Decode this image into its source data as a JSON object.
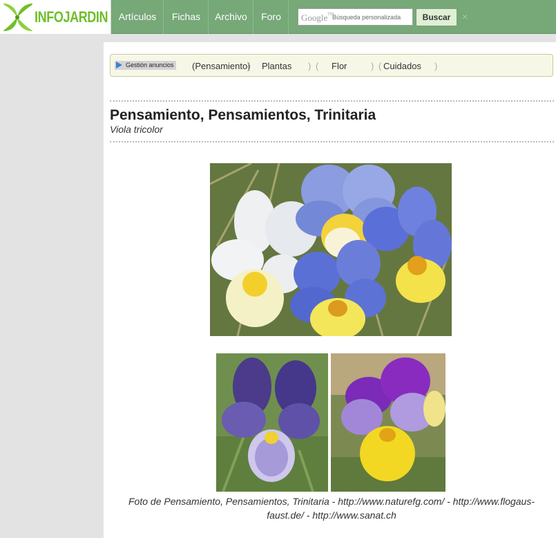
{
  "header": {
    "logo_text": "INFOJARDIN",
    "nav": [
      "Artículos",
      "Fichas",
      "Archivo",
      "Foro"
    ],
    "search": {
      "brand": "Google",
      "brand_tm": "TM",
      "placeholder": "Búsqueda personalizada",
      "button_label": "Buscar",
      "clear_glyph": "×"
    }
  },
  "ad_bar": {
    "label": "Gestión anuncios",
    "links": [
      "Pensamiento",
      "Plantas",
      "Flor",
      "Cuidados"
    ]
  },
  "page": {
    "title": "Pensamiento, Pensamientos, Trinitaria",
    "subtitle": "Viola tricolor"
  },
  "photos": {
    "main": "pansies-main-photo",
    "left": "violet-pansy-photo",
    "right": "yellow-purple-pansy-photo"
  },
  "caption": "Foto de Pensamiento, Pensamientos, Trinitaria - http://www.naturefg.com/ - http://www.flogaus-faust.de/ - http://www.sanat.ch",
  "colors": {
    "header_bg": "#76a878",
    "logo_green": "#6fbf2a",
    "ad_bar_bg": "#f7f7e8",
    "page_bg": "#e3e3e3"
  }
}
